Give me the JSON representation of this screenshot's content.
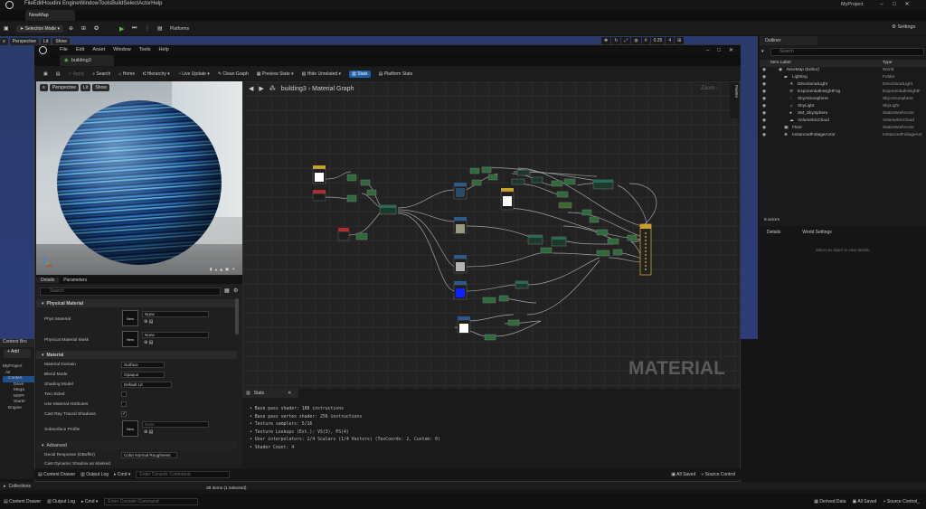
{
  "menubar": {
    "items": [
      "File",
      "Edit",
      "Houdini Engine",
      "Window",
      "Tools",
      "Build",
      "Select",
      "Actor",
      "Help"
    ],
    "project": "MyProject"
  },
  "level_tab": {
    "label": "NewMap"
  },
  "main_toolbar": {
    "mode": "Selection Mode",
    "platforms": "Platforms",
    "settings": "Settings"
  },
  "viewport": {
    "perspective": "Perspective",
    "lit": "Lit",
    "show": "Show",
    "grid_size": "0.25",
    "cam_speed": "4"
  },
  "material_editor": {
    "menu": [
      "File",
      "Edit",
      "Asset",
      "Window",
      "Tools",
      "Help"
    ],
    "tab": "building3",
    "toolbar": [
      "Apply",
      "Search",
      "Home",
      "Hierarchy",
      "Live Update",
      "Clean Graph",
      "Preview State",
      "Hide Unrelated",
      "Stats",
      "Platform Stats"
    ],
    "preview": {
      "perspective": "Perspective",
      "lit": "Lit",
      "show": "Show"
    },
    "breadcrumb": {
      "asset": "building3",
      "graph": "Material Graph"
    },
    "zoom": "Zoom -",
    "palette": "Palette",
    "watermark": "MATERIAL",
    "details": {
      "tab_details": "Details",
      "tab_parameters": "Parameters",
      "search_placeholder": "Search",
      "section_physical": "Physical Material",
      "phys_material": "Phys Material",
      "phys_material_mask": "Physical Material Mask",
      "none": "None",
      "new": "New",
      "section_material": "Material",
      "material_domain": "Material Domain",
      "material_domain_val": "Surface",
      "blend_mode": "Blend Mode",
      "blend_mode_val": "Opaque",
      "shading_model": "Shading Model",
      "shading_model_val": "Default Lit",
      "two_sided": "Two Sided",
      "use_material_attributes": "Use Material Attributes",
      "cast_ray_traced_shadows": "Cast Ray Traced Shadows",
      "subsurface_profile": "Subsurface Profile",
      "section_advanced": "Advanced",
      "decal_response": "Decal Response (DBuffer)",
      "decal_response_val": "Color Normal Roughness",
      "cast_dynamic_shadow": "Cast Dynamic Shadow as Masked"
    },
    "stats": {
      "tab": "Stats",
      "lines": [
        "Base pass shader: 188 instructions",
        "Base pass vertex shader: 256 instructions",
        "Texture samplers: 5/16",
        "Texture Lookups (Est.): VS(3), PS(4)",
        "User interpolators: 2/4 Scalars (1/4 Vectors) (TexCoords: 2, Custom: 0)",
        "Shader Count: 4"
      ]
    },
    "status": {
      "content_drawer": "Content Drawer",
      "output_log": "Output Log",
      "cmd": "Cmd",
      "console_placeholder": "Enter Console Command",
      "all_saved": "All Saved",
      "source_control": "Source Control"
    }
  },
  "content_browser": {
    "tab": "Content Bro",
    "add": "Add",
    "tree": [
      "MyProject",
      "All",
      "Conten",
      "Deve",
      "Mega",
      "MSPr",
      "Starte",
      "Engine"
    ]
  },
  "outliner": {
    "tab": "Outliner",
    "search_placeholder": "Search",
    "col_label": "Item Label",
    "col_type": "Type",
    "rows": [
      {
        "label": "NewMap (Editor)",
        "type": "World"
      },
      {
        "label": "Lighting",
        "type": "Folder"
      },
      {
        "label": "DirectionalLight",
        "type": "DirectionalLight"
      },
      {
        "label": "ExponentialHeightFog",
        "type": "ExponentialHeightF"
      },
      {
        "label": "SkyAtmosphere",
        "type": "SkyAtmosphere"
      },
      {
        "label": "SkyLight",
        "type": "SkyLight"
      },
      {
        "label": "SM_SkySphere",
        "type": "StaticMeshActor"
      },
      {
        "label": "VolumetricCloud",
        "type": "VolumetricCloud"
      },
      {
        "label": "Floor",
        "type": "StaticMeshActor"
      },
      {
        "label": "InstancedFoliageActor",
        "type": "InstancedFoliageAct"
      }
    ],
    "count": "8 actors"
  },
  "details_panel": {
    "tab_details": "Details",
    "tab_world": "World Settings",
    "empty": "Select an object to view details."
  },
  "bottom": {
    "collections": "Collections",
    "items": "38 items (1 selected)",
    "content_drawer": "Content Drawer",
    "output_log": "Output Log",
    "cmd": "Cmd",
    "console_placeholder": "Enter Console Command",
    "derived_data": "Derived Data",
    "all_saved": "All Saved",
    "source_control": "Source Control_"
  },
  "colors": {
    "accent": "#1e5fa6",
    "node_green": "#2d6b3a",
    "node_blue": "#2a5a8a",
    "node_yellow": "#c8a02a",
    "swatch_blue": "#1020ff"
  }
}
